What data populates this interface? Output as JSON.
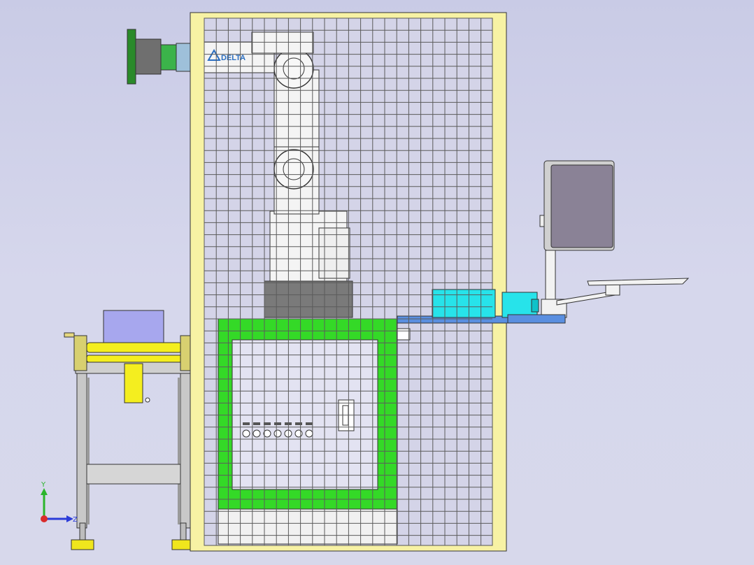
{
  "view": {
    "background_top": "#c9cbe6",
    "background_bottom": "#d7d8eb"
  },
  "colors": {
    "fence_frame": "#f7f2a4",
    "fence_mesh": "#5b5b5b",
    "robot_body": "#f4f4f4",
    "robot_base": "#7a7a7a",
    "table_frame": "#34d927",
    "table_panel": "#e3e3f2",
    "conveyor_roller": "#f4ee1f",
    "conveyor_leg": "#c8c8c8",
    "conveyor_box": "#a7a7ee",
    "cyan_unit": "#27e3ea",
    "blue_plate": "#5a8fe0",
    "monitor_body": "#8a8296",
    "gripper_green": "#2a8a2a"
  },
  "robot": {
    "logo_text": "DELTA",
    "logo_icon": "delta-logo-icon"
  },
  "axis_triad": {
    "y_label": "Y",
    "z_label": "Z",
    "y_color": "#2bb52b",
    "z_color": "#2b3cd9",
    "x_color": "#d92b2b"
  }
}
